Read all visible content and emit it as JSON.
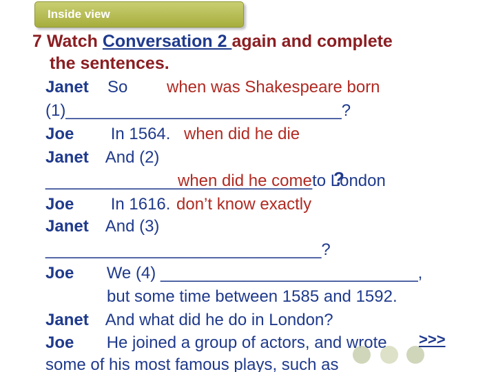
{
  "tab": {
    "label": "Inside view"
  },
  "title": {
    "line1_pre": "7 Watch ",
    "line1_link": "Conversation 2 ",
    "line1_post": "again and complete",
    "line2": "the sentences."
  },
  "dialogue": [
    {
      "speaker": "Janet",
      "text": "So"
    },
    {
      "speaker": "",
      "text": "(1)______________________________?"
    },
    {
      "speaker": "Joe",
      "text": "In 1564."
    },
    {
      "speaker": "Janet",
      "text": "And (2)"
    },
    {
      "speaker": "",
      "text": "_____________________________to London"
    },
    {
      "speaker": "Joe",
      "text": "In 1616."
    },
    {
      "speaker": "Janet",
      "text": "And (3)"
    },
    {
      "speaker": "",
      "text": "______________________________?"
    },
    {
      "speaker": "Joe",
      "text": "We (4) ____________________________,"
    },
    {
      "speaker": "",
      "text": "but some time between 1585 and 1592."
    },
    {
      "speaker": "Janet",
      "text": "And what did he do in London?"
    },
    {
      "speaker": "Joe",
      "text": "He joined a group of actors, and wrote"
    },
    {
      "speaker": "",
      "text": "some of his most famous plays, such as"
    }
  ],
  "answers": {
    "a1": "when was Shakespeare born",
    "a2": "when did he die",
    "a3": "when did he come",
    "a3_mark": "?",
    "a4": "don’t know exactly"
  },
  "next_link": ">>>"
}
